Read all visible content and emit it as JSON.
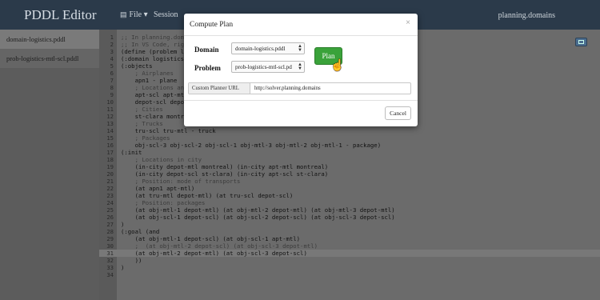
{
  "navbar": {
    "brand": "PDDL Editor",
    "file_label": "File",
    "session_label": "Session",
    "right_label": "planning.domains"
  },
  "sidebar": {
    "items": [
      {
        "label": "domain-logistics.pddl"
      },
      {
        "label": "prob-logistics-mtl-scl.pddl"
      }
    ]
  },
  "editor": {
    "lines": [
      {
        "num": "1",
        "text": ";; In planning.dom"
      },
      {
        "num": "2",
        "text": ";; In VS Code, rig"
      },
      {
        "num": "3",
        "text": "(define (problem lo"
      },
      {
        "num": "4",
        "text": "(:domain logistics-"
      },
      {
        "num": "5",
        "text": "(:objects"
      },
      {
        "num": "6",
        "text": "    ; Airplanes"
      },
      {
        "num": "7",
        "text": "    apn1 - plane"
      },
      {
        "num": "8",
        "text": "    ; Locations and"
      },
      {
        "num": "9",
        "text": "    apt-scl apt-mtl"
      },
      {
        "num": "10",
        "text": "    depot-scl depot"
      },
      {
        "num": "11",
        "text": "    ; Cities"
      },
      {
        "num": "12",
        "text": "    st-clara montre"
      },
      {
        "num": "13",
        "text": "    ; Trucks"
      },
      {
        "num": "14",
        "text": "    tru-scl tru-mtl - truck"
      },
      {
        "num": "15",
        "text": "    ; Packages"
      },
      {
        "num": "16",
        "text": "    obj-scl-3 obj-scl-2 obj-scl-1 obj-mtl-3 obj-mtl-2 obj-mtl-1 - package)"
      },
      {
        "num": "17",
        "text": "(:init"
      },
      {
        "num": "18",
        "text": "    ; Locations in city"
      },
      {
        "num": "19",
        "text": "    (in-city depot-mtl montreal) (in-city apt-mtl montreal)"
      },
      {
        "num": "20",
        "text": "    (in-city depot-scl st-clara) (in-city apt-scl st-clara)"
      },
      {
        "num": "21",
        "text": "    ; Position: mode of transports"
      },
      {
        "num": "22",
        "text": "    (at apn1 apt-mtl)"
      },
      {
        "num": "23",
        "text": "    (at tru-mtl depot-mtl) (at tru-scl depot-scl)"
      },
      {
        "num": "24",
        "text": "    ; Position: packages"
      },
      {
        "num": "25",
        "text": "    (at obj-mtl-1 depot-mtl) (at obj-mtl-2 depot-mtl) (at obj-mtl-3 depot-mtl)"
      },
      {
        "num": "26",
        "text": "    (at obj-scl-1 depot-scl) (at obj-scl-2 depot-scl) (at obj-scl-3 depot-scl)"
      },
      {
        "num": "27",
        "text": ")"
      },
      {
        "num": "28",
        "text": "(:goal (and"
      },
      {
        "num": "29",
        "text": "    (at obj-mtl-1 depot-scl) (at obj-scl-1 apt-mtl)"
      },
      {
        "num": "30",
        "text": "    ;  (at obj-mtl-2 depot-scl) (at obj-scl-3 depot-mtl)"
      },
      {
        "num": "31",
        "text": "    (at obj-mtl-2 depot-mtl) (at obj-scl-3 depot-scl)"
      },
      {
        "num": "32",
        "text": "    ))"
      },
      {
        "num": "33",
        "text": ")"
      },
      {
        "num": "34",
        "text": ""
      }
    ]
  },
  "modal": {
    "title": "Compute Plan",
    "close": "×",
    "domain_label": "Domain",
    "domain_value": "domain-logistics.pddl",
    "problem_label": "Problem",
    "problem_value": "prob-logistics-mtl-scl.pd",
    "plan_button": "Plan",
    "url_addon": "Custom Planner URL",
    "url_value": "http://solver.planning.domains",
    "cancel_button": "Cancel"
  },
  "colors": {
    "navbar": "#2b3a4a",
    "plan_button": "#3aa23a"
  }
}
